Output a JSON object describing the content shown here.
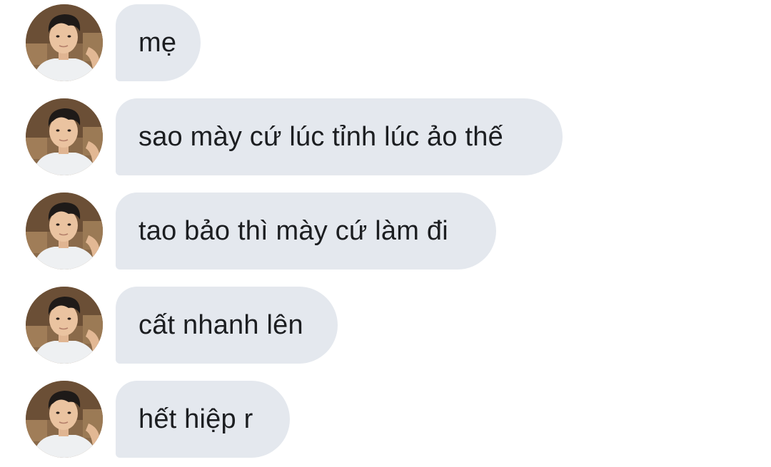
{
  "conversation": {
    "messages": [
      {
        "text": "mẹ"
      },
      {
        "text": "sao mày cứ lúc tỉnh lúc ảo thế"
      },
      {
        "text": "tao bảo thì mày cứ làm đi"
      },
      {
        "text": "cất nhanh lên"
      },
      {
        "text": "hết hiệp r"
      }
    ]
  },
  "colors": {
    "bubble_background": "#e4e8ee",
    "text": "#1c1e21",
    "page_background": "#ffffff"
  },
  "icons": {
    "sender_avatar": "profile-photo"
  }
}
